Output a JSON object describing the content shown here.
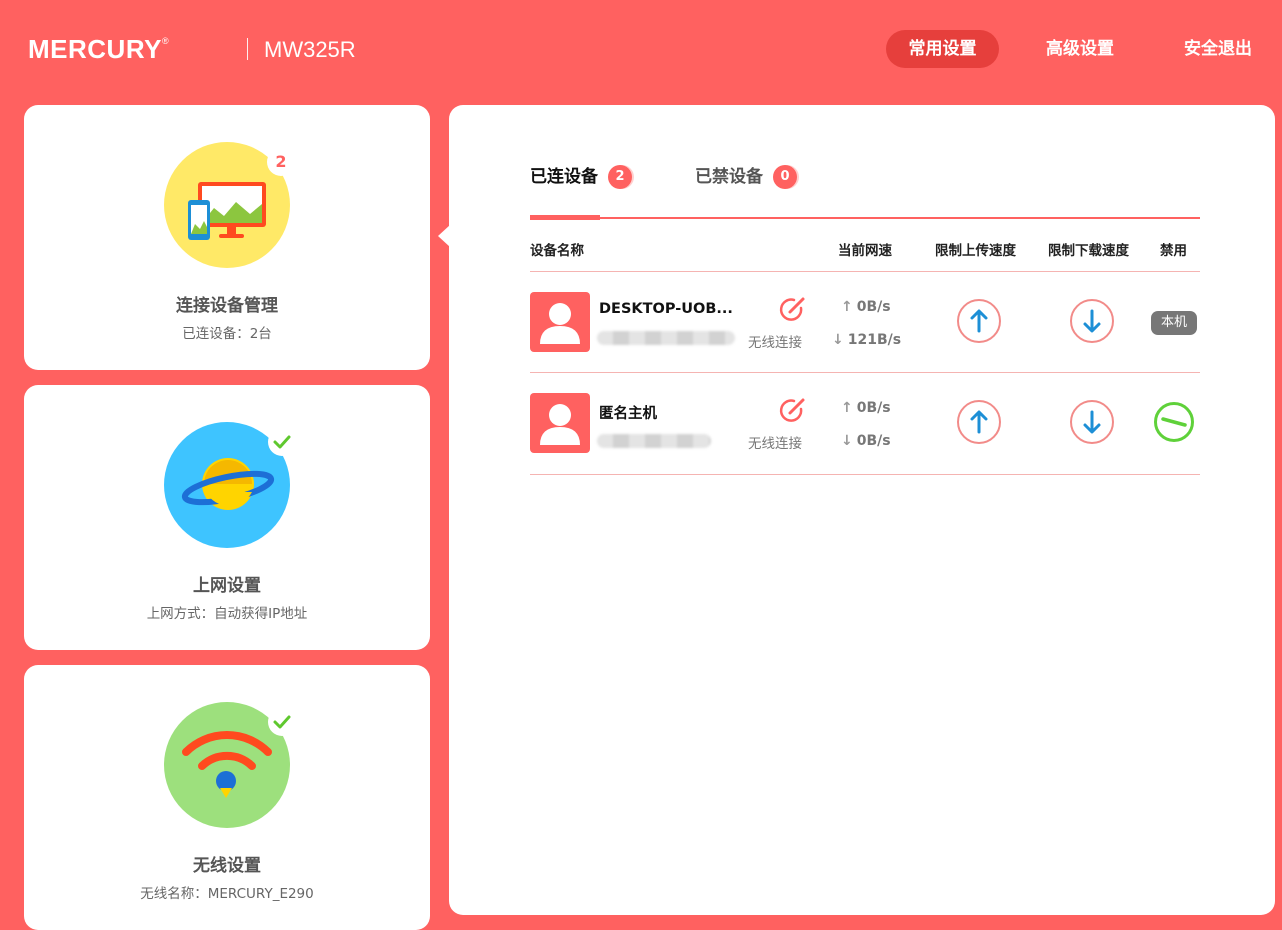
{
  "header": {
    "brand": "MERCURY",
    "brand_mark": "®",
    "model": "MW325R",
    "nav": [
      {
        "label": "常用设置",
        "active": true
      },
      {
        "label": "高级设置",
        "active": false
      },
      {
        "label": "安全退出",
        "active": false
      }
    ]
  },
  "sidebar": {
    "cards": [
      {
        "title": "连接设备管理",
        "subtitle": "已连设备：2台",
        "badge": "2",
        "icon": "devices-icon",
        "color": "#ffe967"
      },
      {
        "title": "上网设置",
        "subtitle": "上网方式：自动获得IP地址",
        "icon": "planet-icon",
        "status": "check",
        "color": "#3ec4ff"
      },
      {
        "title": "无线设置",
        "subtitle": "无线名称：MERCURY_E290",
        "icon": "wifi-icon",
        "status": "check",
        "color": "#9de07d"
      }
    ]
  },
  "tabs": [
    {
      "label": "已连设备",
      "count": "2",
      "active": true
    },
    {
      "label": "已禁设备",
      "count": "0",
      "active": false
    }
  ],
  "table": {
    "headers": {
      "name": "设备名称",
      "speed": "当前网速",
      "upload_limit": "限制上传速度",
      "download_limit": "限制下载速度",
      "block": "禁用"
    },
    "rows": [
      {
        "name": "DESKTOP-UOB...",
        "conn": "无线连接",
        "up": "0B/s",
        "down": "121B/s",
        "block_label": "本机"
      },
      {
        "name": "匿名主机",
        "conn": "无线连接",
        "up": "0B/s",
        "down": "0B/s",
        "block_label": ""
      }
    ]
  },
  "colors": {
    "accent": "#ff6160",
    "nav_active": "#e63f3c",
    "arrow_blue": "#1d8fd6",
    "block_green": "#5fd13a"
  }
}
